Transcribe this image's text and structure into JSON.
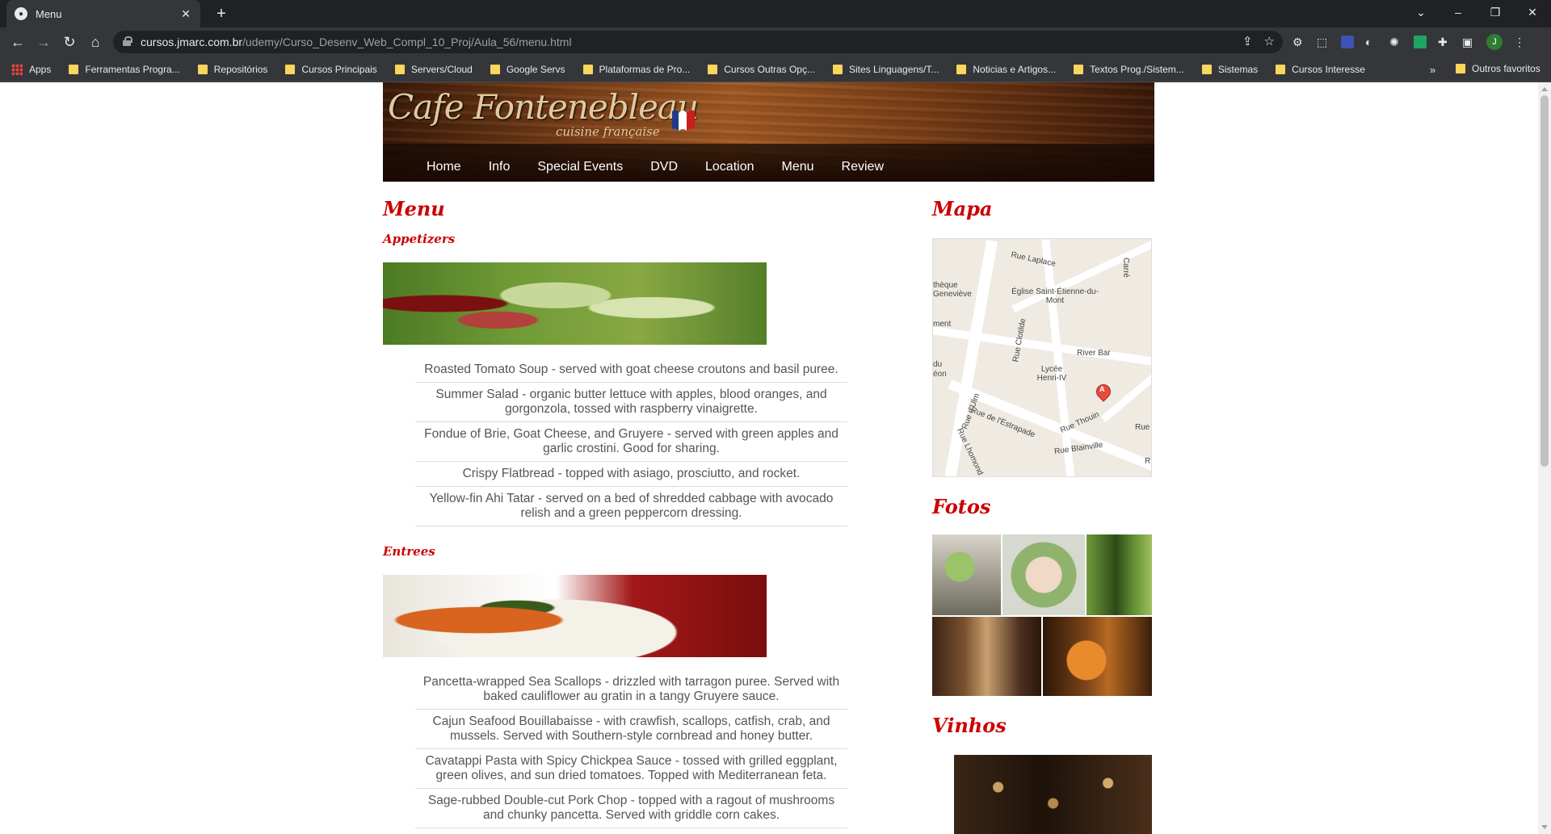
{
  "browser": {
    "tab_title": "Menu",
    "url_host": "cursos.jmarc.com.br",
    "url_path": "/udemy/Curso_Desenv_Web_Compl_10_Proj/Aula_56/menu.html",
    "bookmarks": [
      "Apps",
      "Ferramentas Progra...",
      "Repositórios",
      "Cursos Principais",
      "Servers/Cloud",
      "Google Servs",
      "Plataformas de Pro...",
      "Cursos Outras Opç...",
      "Sites Linguagens/T...",
      "Noticias e Artigos...",
      "Textos Prog./Sistem...",
      "Sistemas",
      "Cursos Interesse"
    ],
    "bookmarks_more": "»",
    "other_bookmarks": "Outros favoritos",
    "profile_initial": "J"
  },
  "site": {
    "logo": "Cafe Fontenebleau",
    "tagline": "cuisine française",
    "nav": [
      "Home",
      "Info",
      "Special Events",
      "DVD",
      "Location",
      "Menu",
      "Review"
    ]
  },
  "menu": {
    "title": "Menu",
    "appetizers_title": "Appetizers",
    "appetizers": [
      "Roasted Tomato Soup - served with goat cheese croutons and basil puree.",
      "Summer Salad - organic butter lettuce with apples, blood oranges, and gorgonzola, tossed with raspberry vinaigrette.",
      "Fondue of Brie, Goat Cheese, and Gruyere - served with green apples and garlic crostini. Good for sharing.",
      "Crispy Flatbread - topped with asiago, prosciutto, and rocket.",
      "Yellow-fin Ahi Tatar - served on a bed of shredded cabbage with avocado relish and a green peppercorn dressing."
    ],
    "entrees_title": "Entrees",
    "entrees": [
      "Pancetta-wrapped Sea Scallops - drizzled with tarragon puree. Served with baked cauliflower au gratin in a tangy Gruyere sauce.",
      "Cajun Seafood Bouillabaisse - with crawfish, scallops, catfish, crab, and mussels. Served with Southern-style cornbread and honey butter.",
      "Cavatappi Pasta with Spicy Chickpea Sauce - tossed with grilled eggplant, green olives, and sun dried tomatoes. Topped with Mediterranean feta.",
      "Sage-rubbed Double-cut Pork Chop - topped with a ragout of mushrooms and chunky pancetta. Served with griddle corn cakes."
    ]
  },
  "sidebar": {
    "map_title": "Mapa",
    "photos_title": "Fotos",
    "wines_title": "Vinhos",
    "map_labels": [
      "Rue Laplace",
      "Église Saint-Étienne-du-Mont",
      "thèque Geneviève",
      "ment",
      "Rue Clotilde",
      "River Bar",
      "Lycée Henri-IV",
      "du",
      "éon",
      "Rue d'Ulm",
      "Rue de l'Estrapade",
      "Rue Thouin",
      "Rue Blainville",
      "Rue Lhomond",
      "Rue",
      "Carré",
      "R"
    ],
    "pin_label": "A"
  }
}
